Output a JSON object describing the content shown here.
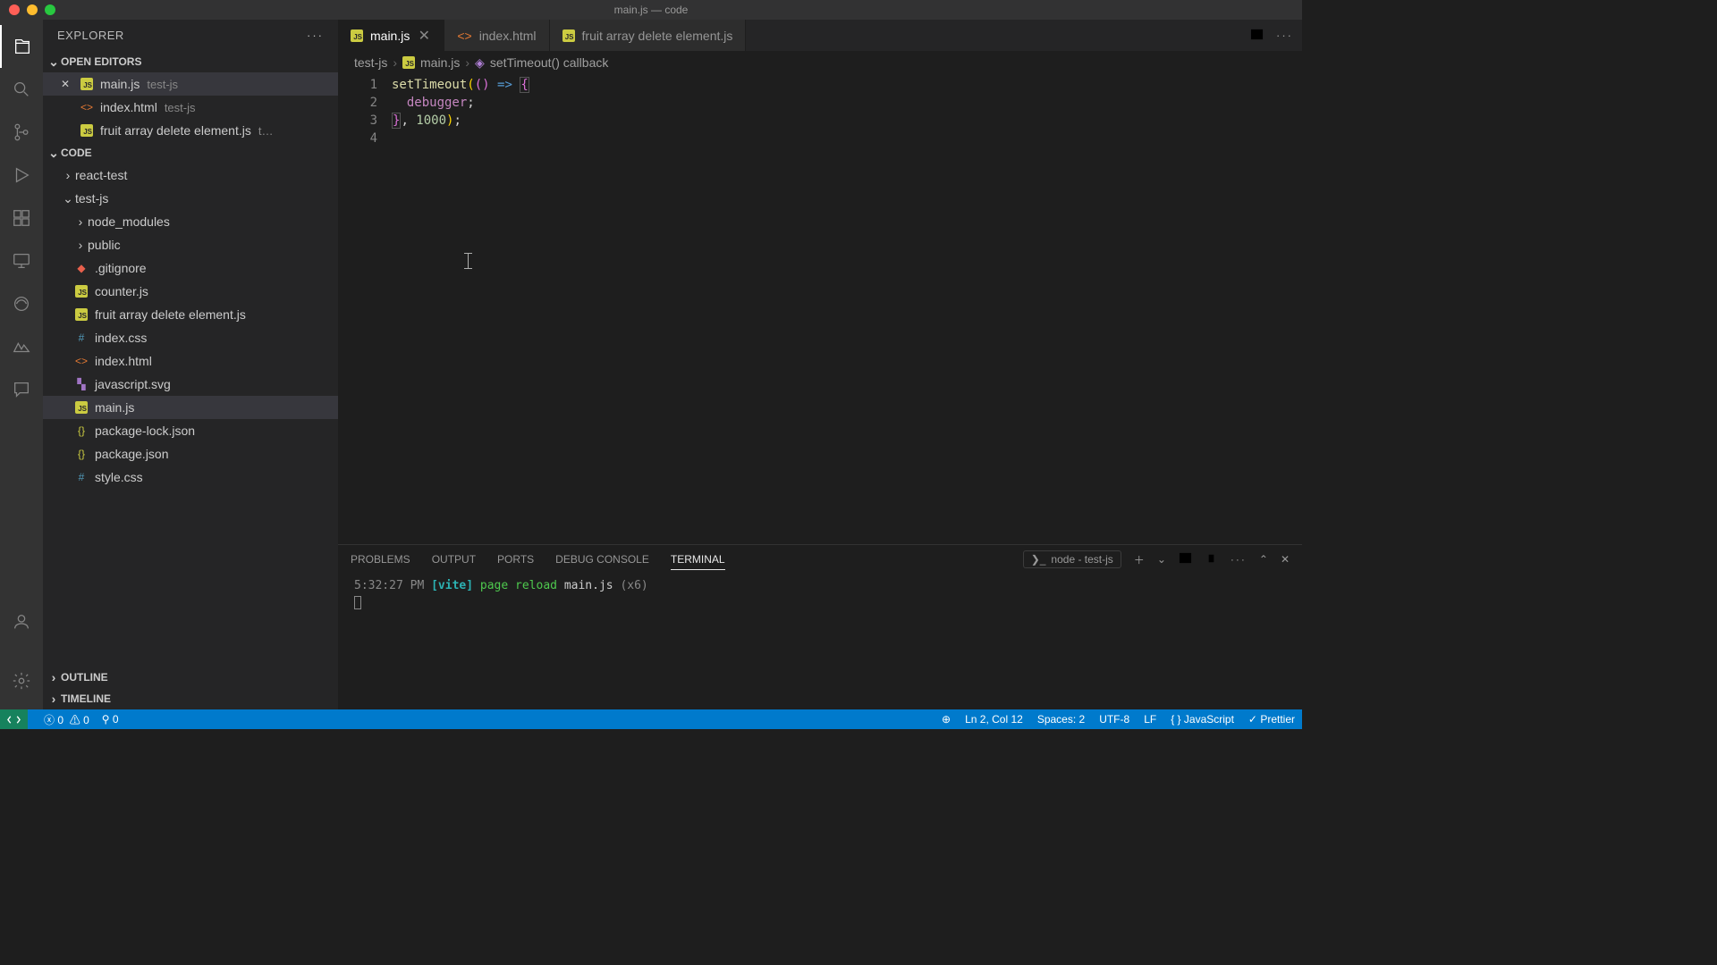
{
  "window": {
    "title": "main.js — code"
  },
  "explorer": {
    "title": "EXPLORER",
    "sections": {
      "open_editors": "OPEN EDITORS",
      "code": "CODE",
      "outline": "OUTLINE",
      "timeline": "TIMELINE"
    },
    "open_editors_items": [
      {
        "name": "main.js",
        "dir": "test-js",
        "icon": "js",
        "closeable": true
      },
      {
        "name": "index.html",
        "dir": "test-js",
        "icon": "html",
        "closeable": false
      },
      {
        "name": "fruit array delete element.js",
        "dir": "t…",
        "icon": "js",
        "closeable": false
      }
    ],
    "tree": [
      {
        "name": "react-test",
        "type": "folder",
        "expanded": false,
        "depth": 0
      },
      {
        "name": "test-js",
        "type": "folder",
        "expanded": true,
        "depth": 0
      },
      {
        "name": "node_modules",
        "type": "folder",
        "expanded": false,
        "depth": 1
      },
      {
        "name": "public",
        "type": "folder",
        "expanded": false,
        "depth": 1
      },
      {
        "name": ".gitignore",
        "type": "file",
        "icon": "git",
        "depth": 1
      },
      {
        "name": "counter.js",
        "type": "file",
        "icon": "js",
        "depth": 1
      },
      {
        "name": "fruit array delete element.js",
        "type": "file",
        "icon": "js",
        "depth": 1
      },
      {
        "name": "index.css",
        "type": "file",
        "icon": "css",
        "depth": 1
      },
      {
        "name": "index.html",
        "type": "file",
        "icon": "html",
        "depth": 1
      },
      {
        "name": "javascript.svg",
        "type": "file",
        "icon": "svg",
        "depth": 1
      },
      {
        "name": "main.js",
        "type": "file",
        "icon": "js",
        "depth": 1,
        "active": true
      },
      {
        "name": "package-lock.json",
        "type": "file",
        "icon": "json",
        "depth": 1
      },
      {
        "name": "package.json",
        "type": "file",
        "icon": "json",
        "depth": 1
      },
      {
        "name": "style.css",
        "type": "file",
        "icon": "css",
        "depth": 1
      }
    ]
  },
  "tabs": [
    {
      "name": "main.js",
      "icon": "js",
      "active": true,
      "dirty": false
    },
    {
      "name": "index.html",
      "icon": "html",
      "active": false
    },
    {
      "name": "fruit array delete element.js",
      "icon": "js",
      "active": false
    }
  ],
  "breadcrumbs": {
    "parts": [
      "test-js",
      "main.js",
      "setTimeout() callback"
    ],
    "icons": [
      "",
      "js",
      "symbol"
    ]
  },
  "editor": {
    "lines": [
      "1",
      "2",
      "3",
      "4"
    ],
    "code": {
      "l1_fn": "setTimeout",
      "l1_rest_open": "((",
      "l1_rest_close": ")",
      "l1_arrow": " => ",
      "l1_brace": "{",
      "l2_kw": "debugger",
      "l2_semi": ";",
      "l3_close": "}",
      "l3_rest": ", ",
      "l3_num": "1000",
      "l3_end": ");"
    }
  },
  "panel": {
    "tabs": [
      "PROBLEMS",
      "OUTPUT",
      "PORTS",
      "DEBUG CONSOLE",
      "TERMINAL"
    ],
    "active_tab": "TERMINAL",
    "terminal_selector": "node - test-js",
    "terminal_line": {
      "time": "5:32:27 PM ",
      "vite": "[vite]",
      "action": " page reload ",
      "file": "main.js ",
      "count": "(x6)"
    }
  },
  "statusbar": {
    "errors": "0",
    "warnings": "0",
    "ports": "0",
    "position": "Ln 2, Col 12",
    "spaces": "Spaces: 2",
    "encoding": "UTF-8",
    "eol": "LF",
    "language": "JavaScript",
    "prettier": "Prettier"
  }
}
